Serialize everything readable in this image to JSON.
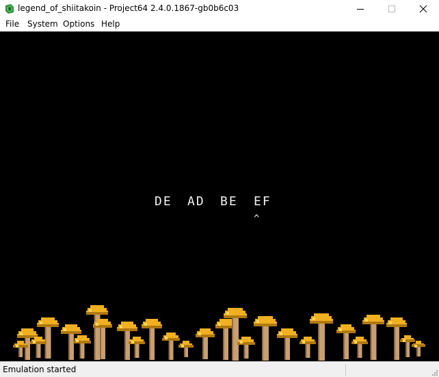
{
  "window": {
    "title": "legend_of_shiitakoin - Project64 2.4.0.1867-gb0b6c03",
    "icon": "project64-icon",
    "controls": [
      "minimize-icon",
      "maximize-icon",
      "close-icon"
    ]
  },
  "menu": {
    "items": [
      {
        "label": "File"
      },
      {
        "label": "System"
      },
      {
        "label": "Options"
      },
      {
        "label": "Help"
      }
    ]
  },
  "game": {
    "hex_bytes": [
      "DE",
      "AD",
      "BE",
      "EF"
    ],
    "cursor_glyph": "^",
    "colors": {
      "background": "#000000",
      "text": "#f2f2f2",
      "mushroom_cap": "#f0b020",
      "mushroom_cap_shade": "#b07810",
      "mushroom_stem": "#c8a070"
    }
  },
  "status": {
    "text": "Emulation started"
  }
}
